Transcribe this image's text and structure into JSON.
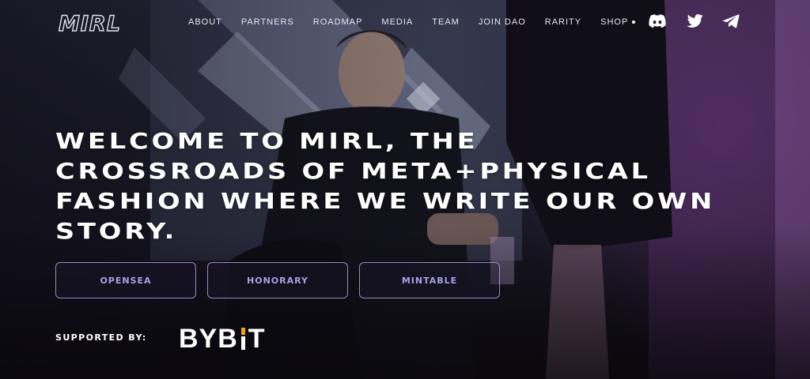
{
  "brand": {
    "logo_text": "MIRL"
  },
  "nav": {
    "items": [
      {
        "label": "ABOUT"
      },
      {
        "label": "PARTNERS"
      },
      {
        "label": "ROADMAP"
      },
      {
        "label": "MEDIA"
      },
      {
        "label": "TEAM"
      },
      {
        "label": "JOIN DAO"
      },
      {
        "label": "RARITY"
      },
      {
        "label": "SHOP"
      }
    ],
    "social": [
      "discord-icon",
      "twitter-icon",
      "telegram-icon"
    ]
  },
  "hero": {
    "headline": "WELCOME TO MIRL, THE\nCROSSROADS OF META+PHYSICAL\nFASHION WHERE WE WRITE OUR OWN\nSTORY.",
    "buttons": [
      {
        "label": "OPENSEA"
      },
      {
        "label": "HONORARY"
      },
      {
        "label": "MINTABLE"
      }
    ],
    "supported_label": "SUPPORTED BY:",
    "sponsor": {
      "pre": "BYB",
      "post": "T"
    }
  },
  "colors": {
    "accent_outline": "#b4aaeb",
    "button_text": "#a8a0e6",
    "bybit_orange": "#f7a600"
  }
}
